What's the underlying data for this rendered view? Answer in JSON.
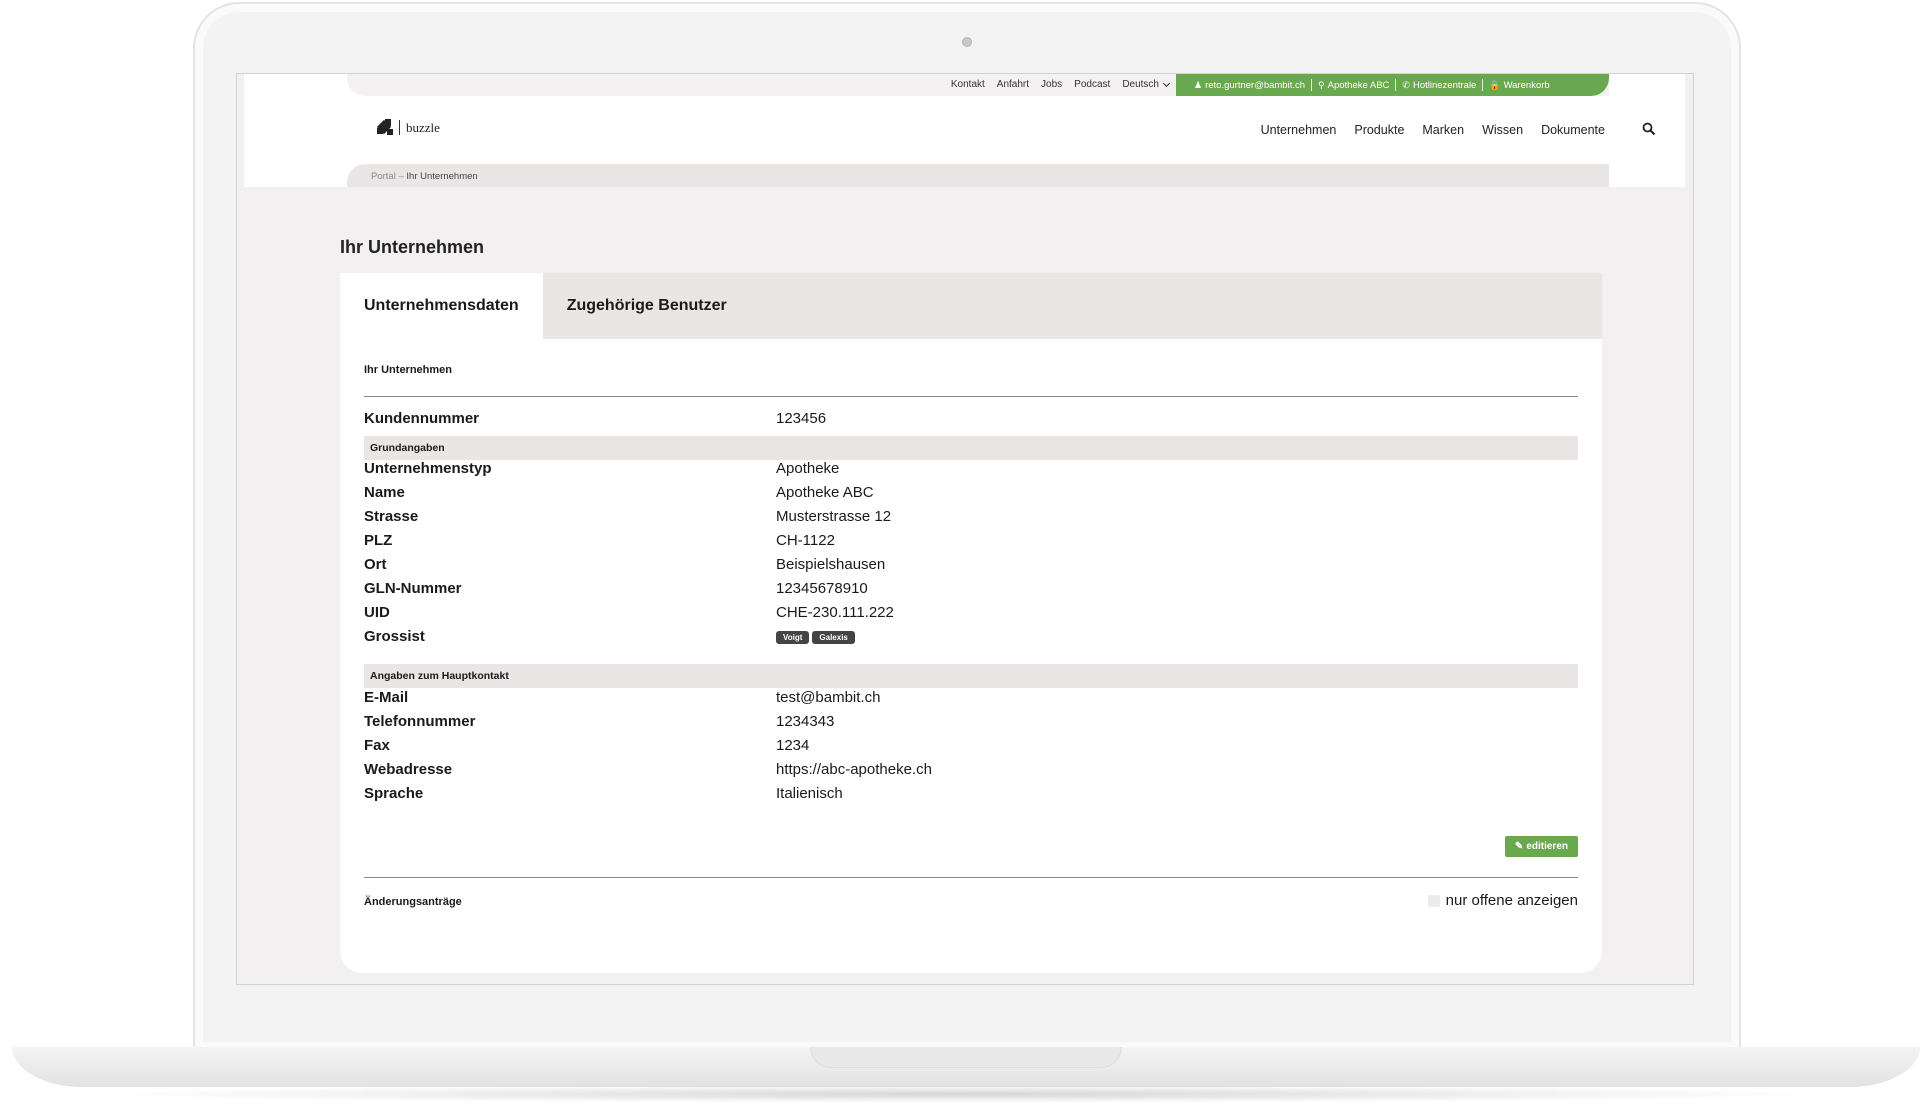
{
  "topbar": {
    "links": [
      "Kontakt",
      "Anfahrt",
      "Jobs",
      "Podcast"
    ],
    "language": "Deutsch",
    "account": {
      "email": "reto.gurtner@bambit.ch",
      "pharmacy": "Apotheke ABC",
      "hotline": "Hotlinezentrale",
      "cart": "Warenkorb"
    }
  },
  "brand": {
    "name": "buzzle"
  },
  "nav": {
    "items": [
      "Unternehmen",
      "Produkte",
      "Marken",
      "Wissen",
      "Dokumente"
    ]
  },
  "breadcrumb": {
    "root": "Portal",
    "separator": "–",
    "current": "Ihr Unternehmen"
  },
  "page": {
    "title": "Ihr Unternehmen"
  },
  "tabs": [
    "Unternehmensdaten",
    "Zugehörige Benutzer"
  ],
  "company": {
    "section_title": "Ihr Unternehmen",
    "customer_number": {
      "label": "Kundennummer",
      "value": "123456"
    },
    "basics": {
      "title": "Grundangaben",
      "fields": [
        {
          "label": "Unternehmenstyp",
          "value": "Apotheke"
        },
        {
          "label": "Name",
          "value": "Apotheke ABC"
        },
        {
          "label": "Strasse",
          "value": "Musterstrasse 12"
        },
        {
          "label": "PLZ",
          "value": "CH-1122"
        },
        {
          "label": "Ort",
          "value": "Beispielshausen"
        },
        {
          "label": "GLN-Nummer",
          "value": "12345678910"
        },
        {
          "label": "UID",
          "value": "CHE-230.111.222"
        }
      ],
      "wholesaler_label": "Grossist",
      "wholesalers": [
        "Voigt",
        "Galexis"
      ]
    },
    "contact": {
      "title": "Angaben zum Hauptkontakt",
      "fields": [
        {
          "label": "E-Mail",
          "value": "test@bambit.ch"
        },
        {
          "label": "Telefonnummer",
          "value": "1234343"
        },
        {
          "label": "Fax",
          "value": "1234"
        },
        {
          "label": "Webadresse",
          "value": "https://abc-apotheke.ch"
        },
        {
          "label": "Sprache",
          "value": "Italienisch"
        }
      ]
    },
    "edit_label": "editieren"
  },
  "change_requests": {
    "title": "Änderungsanträge",
    "filter_label": "nur offene anzeigen",
    "filter_checked": false
  },
  "colors": {
    "accent": "#6aa84f",
    "band": "#ebe6e6",
    "badge": "#444444"
  }
}
